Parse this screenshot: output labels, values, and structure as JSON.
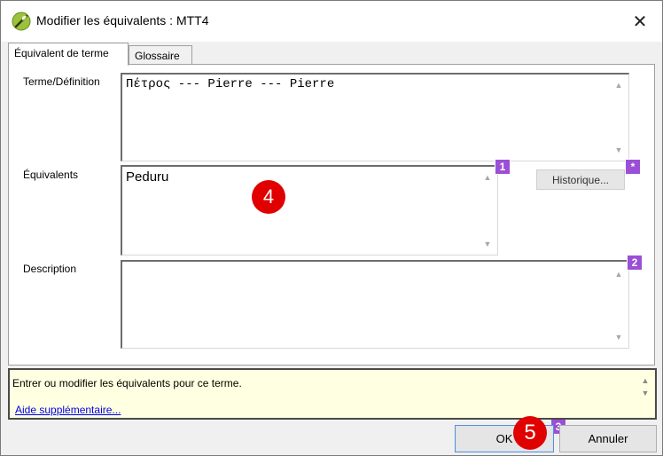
{
  "window": {
    "title": "Modifier les équivalents : MTT4",
    "close_glyph": "✕"
  },
  "tabs": [
    {
      "label": "Équivalent de terme",
      "active": true
    },
    {
      "label": "Glossaire",
      "active": false
    }
  ],
  "fields": {
    "term": {
      "label": "Terme/Définition",
      "value": "Πέτρος --- Pierre --- Pierre"
    },
    "equivalents": {
      "label": "Équivalents",
      "value": "Peduru"
    },
    "description": {
      "label": "Description",
      "value": ""
    }
  },
  "history_button": "Historique...",
  "badges": {
    "b1": "1",
    "b_star": "*",
    "b2": "2",
    "b3": "3"
  },
  "markers": {
    "m4": "4",
    "m5": "5"
  },
  "help": {
    "text": "Entrer ou modifier les équivalents pour ce terme.",
    "link": "Aide supplémentaire..."
  },
  "buttons": {
    "ok": "OK",
    "cancel": "Annuler"
  },
  "colors": {
    "badge": "#9b4fd6",
    "marker": "#e00000",
    "help_bg": "#ffffe1",
    "link": "#0000ee"
  }
}
